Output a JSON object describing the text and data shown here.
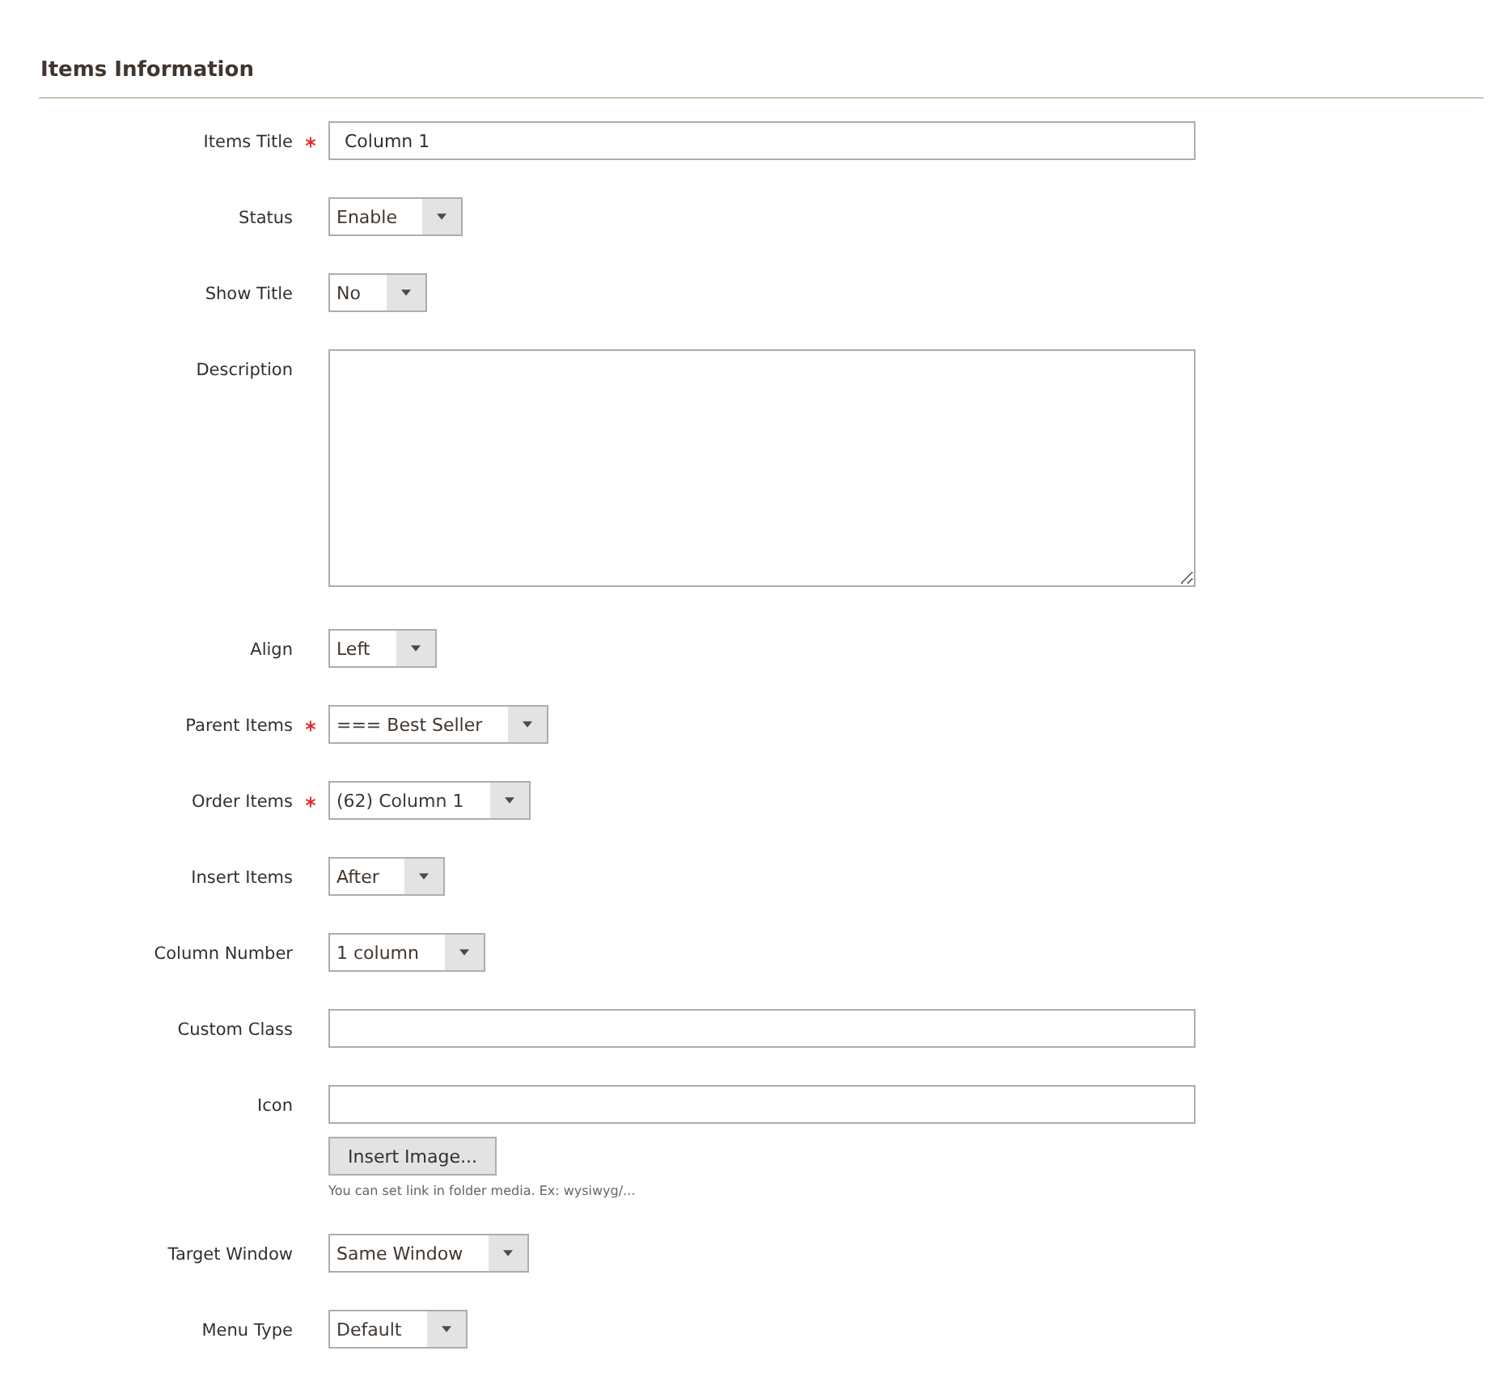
{
  "section": {
    "title": "Items Information"
  },
  "fields": [
    {
      "kind": "text",
      "label": "Items Title",
      "required": true,
      "value": "Column 1"
    },
    {
      "kind": "select",
      "label": "Status",
      "required": false,
      "value": "Enable"
    },
    {
      "kind": "select",
      "label": "Show Title",
      "required": false,
      "value": "No"
    },
    {
      "kind": "textarea",
      "label": "Description",
      "required": false
    },
    {
      "kind": "select",
      "label": "Align",
      "required": false,
      "value": "Left"
    },
    {
      "kind": "select",
      "label": "Parent Items",
      "required": true,
      "value": "=== Best Seller"
    },
    {
      "kind": "select",
      "label": "Order Items",
      "required": true,
      "value": "(62) Column 1"
    },
    {
      "kind": "select",
      "label": "Insert Items",
      "required": false,
      "value": "After"
    },
    {
      "kind": "select",
      "label": "Column Number",
      "required": false,
      "value": "1 column"
    },
    {
      "kind": "text",
      "label": "Custom Class",
      "required": false
    },
    {
      "kind": "text",
      "label": "Icon",
      "required": false,
      "button": "Insert Image...",
      "note": "You can set link in folder media. Ex: wysiwyg/..."
    },
    {
      "kind": "select",
      "label": "Target Window",
      "required": false,
      "value": "Same Window"
    },
    {
      "kind": "select",
      "label": "Menu Type",
      "required": false,
      "value": "Default"
    }
  ]
}
